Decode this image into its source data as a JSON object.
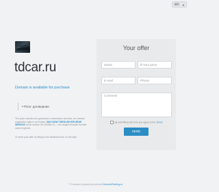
{
  "language": {
    "selected": "en"
  },
  "domain": {
    "name": "tdcar.ru",
    "available_text": "Domain is available for purchase"
  },
  "keyword": "Price: договорная",
  "info": {
    "text1": "The price includes the guarantor's commission services; the domain registration data is not hidden.",
    "link": "BUY NOW THROUGH ESCROW SERVICE",
    "text2": "at the service 30-1234567-8 — the largest Russian domain name registrar.",
    "text3": "Or send your offer by filling in the feedback form on the right."
  },
  "offer_form": {
    "title": "Your offer",
    "name_placeholder": "Name",
    "price_placeholder": "₽ Your price",
    "email_placeholder": "E-mail",
    "phone_placeholder": "Phone",
    "comment_placeholder": "Comment",
    "consent_text": "By submitting this form you agree to the",
    "consent_link": "Terms",
    "send_label": "SEND"
  },
  "footer": {
    "text": "© Domain is parked by service",
    "link": "DomainParking.ru"
  }
}
